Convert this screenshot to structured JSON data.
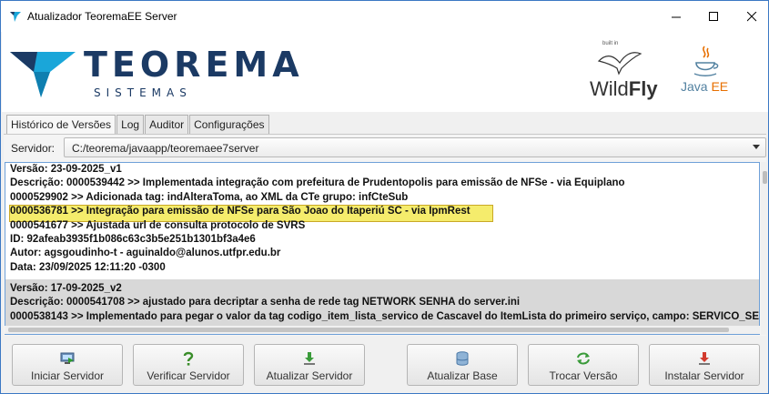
{
  "window": {
    "title": "Atualizador TeoremaEE Server"
  },
  "brand": {
    "name": "TEOREMA",
    "subtitle": "SISTEMAS",
    "wildfly_built": "built in",
    "wildfly_a": "Wild",
    "wildfly_b": "Fly",
    "javaee_a": "Java",
    "javaee_b": " EE"
  },
  "tabs": [
    {
      "label": "Histórico de Versões",
      "active": true
    },
    {
      "label": "Log",
      "active": false
    },
    {
      "label": "Auditor",
      "active": false
    },
    {
      "label": "Configurações",
      "active": false
    }
  ],
  "server": {
    "label": "Servidor:",
    "value": "C:/teorema/javaapp/teoremaee7server"
  },
  "entries": [
    {
      "lines": [
        "Versão: 23-09-2025_v1",
        "Descrição: 0000539442 >> Implementada integração com prefeitura de Prudentopolis para emissão de NFSe - via Equiplano",
        "0000529902 >> Adicionada tag: indAlteraToma, ao XML da CTe grupo: infCteSub",
        "0000536781 >> Integração para emissão de NFSe para São Joao do Itaperiú SC - via IpmRest",
        "0000541677 >> Ajustada url de consulta protocolo de SVRS",
        "ID: 92afeab3935f1b086c63c3b5e251b1301bf3a4e6",
        "Autor: agsgoudinho-t - aguinaldo@alunos.utfpr.edu.br",
        "Data: 23/09/2025 12:11:20 -0300"
      ]
    },
    {
      "lines": [
        "Versão: 17-09-2025_v2",
        "Descrição: 0000541708 >> ajustado para decriptar a senha de rede tag NETWORK SENHA do server.ini",
        "0000538143 >> Implementado para pegar o valor da tag codigo_item_lista_servico de Cascavel do ItemLista do primeiro serviço, campo: SERVICO_SERV_CODIGO"
      ]
    }
  ],
  "buttons": {
    "start": "Iniciar Servidor",
    "verify": "Verificar Servidor",
    "update": "Atualizar Servidor",
    "update_base": "Atualizar Base",
    "switch_version": "Trocar Versão",
    "install": "Instalar Servidor"
  },
  "colors": {
    "brand_navy": "#1b3a64",
    "brand_teal": "#1aa6d9",
    "highlight": "#f5ec6c",
    "selection_border": "#6ea0d8"
  }
}
